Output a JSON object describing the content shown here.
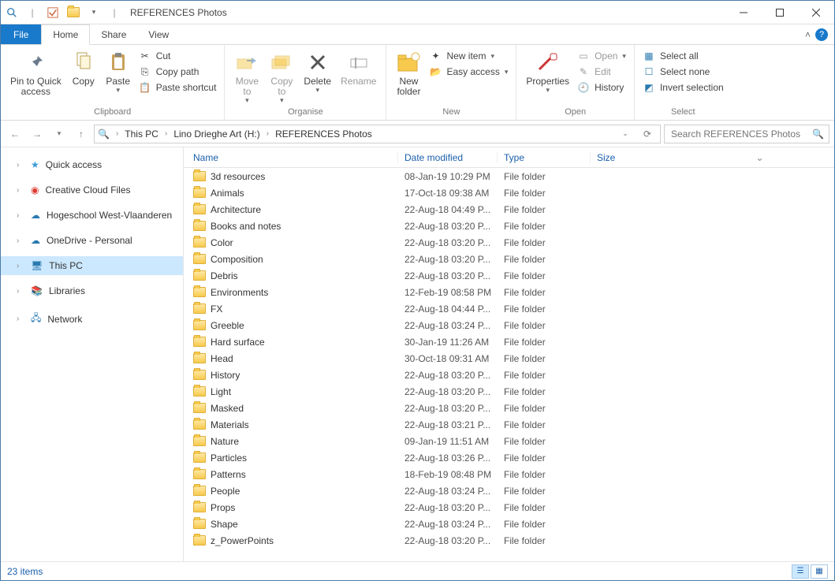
{
  "title": "REFERENCES Photos",
  "tabs": {
    "file": "File",
    "home": "Home",
    "share": "Share",
    "view": "View"
  },
  "ribbon": {
    "clipboard": {
      "pin": "Pin to Quick\naccess",
      "copy": "Copy",
      "paste": "Paste",
      "cut": "Cut",
      "copy_path": "Copy path",
      "paste_shortcut": "Paste shortcut",
      "label": "Clipboard"
    },
    "organise": {
      "move_to": "Move\nto",
      "copy_to": "Copy\nto",
      "delete": "Delete",
      "rename": "Rename",
      "label": "Organise"
    },
    "new": {
      "new_folder": "New\nfolder",
      "new_item": "New item",
      "easy_access": "Easy access",
      "label": "New"
    },
    "open": {
      "properties": "Properties",
      "open": "Open",
      "edit": "Edit",
      "history": "History",
      "label": "Open"
    },
    "select": {
      "select_all": "Select all",
      "select_none": "Select none",
      "invert": "Invert selection",
      "label": "Select"
    }
  },
  "breadcrumbs": [
    "This PC",
    "Lino Drieghe Art (H:)",
    "REFERENCES Photos"
  ],
  "search_placeholder": "Search REFERENCES Photos",
  "nav": {
    "quick_access": "Quick access",
    "creative_cloud": "Creative Cloud Files",
    "hogeschool": "Hogeschool West-Vlaanderen",
    "onedrive": "OneDrive - Personal",
    "this_pc": "This PC",
    "libraries": "Libraries",
    "network": "Network"
  },
  "columns": {
    "name": "Name",
    "date": "Date modified",
    "type": "Type",
    "size": "Size"
  },
  "folders": [
    {
      "name": "3d resources",
      "date": "08-Jan-19 10:29 PM",
      "type": "File folder"
    },
    {
      "name": "Animals",
      "date": "17-Oct-18 09:38 AM",
      "type": "File folder"
    },
    {
      "name": "Architecture",
      "date": "22-Aug-18 04:49 P...",
      "type": "File folder"
    },
    {
      "name": "Books and notes",
      "date": "22-Aug-18 03:20 P...",
      "type": "File folder"
    },
    {
      "name": "Color",
      "date": "22-Aug-18 03:20 P...",
      "type": "File folder"
    },
    {
      "name": "Composition",
      "date": "22-Aug-18 03:20 P...",
      "type": "File folder"
    },
    {
      "name": "Debris",
      "date": "22-Aug-18 03:20 P...",
      "type": "File folder"
    },
    {
      "name": "Environments",
      "date": "12-Feb-19 08:58 PM",
      "type": "File folder"
    },
    {
      "name": "FX",
      "date": "22-Aug-18 04:44 P...",
      "type": "File folder"
    },
    {
      "name": "Greeble",
      "date": "22-Aug-18 03:24 P...",
      "type": "File folder"
    },
    {
      "name": "Hard surface",
      "date": "30-Jan-19 11:26 AM",
      "type": "File folder"
    },
    {
      "name": "Head",
      "date": "30-Oct-18 09:31 AM",
      "type": "File folder"
    },
    {
      "name": "History",
      "date": "22-Aug-18 03:20 P...",
      "type": "File folder"
    },
    {
      "name": "Light",
      "date": "22-Aug-18 03:20 P...",
      "type": "File folder"
    },
    {
      "name": "Masked",
      "date": "22-Aug-18 03:20 P...",
      "type": "File folder"
    },
    {
      "name": "Materials",
      "date": "22-Aug-18 03:21 P...",
      "type": "File folder"
    },
    {
      "name": "Nature",
      "date": "09-Jan-19 11:51 AM",
      "type": "File folder"
    },
    {
      "name": "Particles",
      "date": "22-Aug-18 03:26 P...",
      "type": "File folder"
    },
    {
      "name": "Patterns",
      "date": "18-Feb-19 08:48 PM",
      "type": "File folder"
    },
    {
      "name": "People",
      "date": "22-Aug-18 03:24 P...",
      "type": "File folder"
    },
    {
      "name": "Props",
      "date": "22-Aug-18 03:20 P...",
      "type": "File folder"
    },
    {
      "name": "Shape",
      "date": "22-Aug-18 03:24 P...",
      "type": "File folder"
    },
    {
      "name": "z_PowerPoints",
      "date": "22-Aug-18 03:20 P...",
      "type": "File folder"
    }
  ],
  "status": "23 items"
}
